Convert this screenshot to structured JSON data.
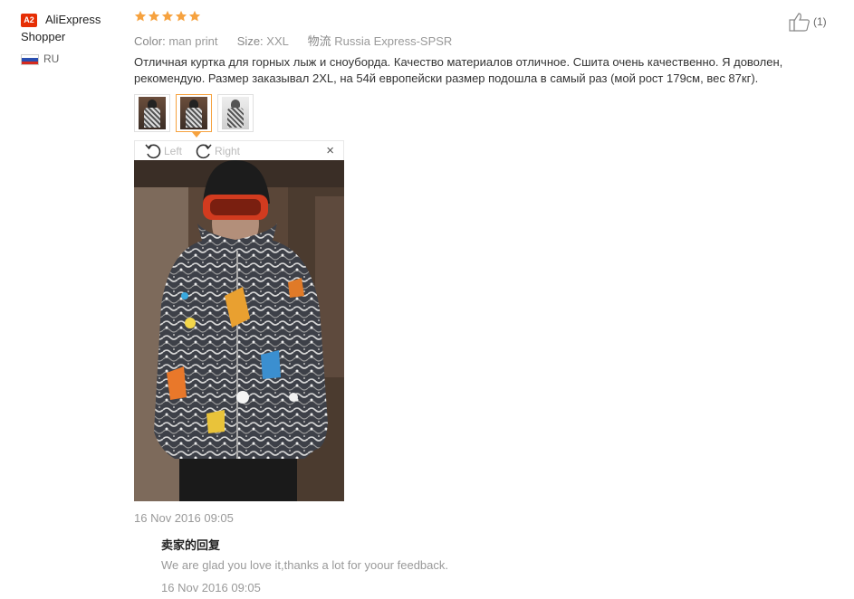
{
  "user": {
    "badge": "A2",
    "name": "AliExpress Shopper",
    "country": "RU",
    "flag_colors": [
      "#ffffff",
      "#2a4fb0",
      "#d52b1e"
    ]
  },
  "review": {
    "rating": 5,
    "star_color": "#f6a23f",
    "color_label": "Color:",
    "color_value": "man print",
    "size_label": "Size:",
    "size_value": "XXL",
    "shipping_label": "物流",
    "shipping_value": "Russia Express-SPSR",
    "text": "Отличная куртка для горных лыж и сноуборда. Качество материалов отличное. Сшита очень качественно. Я доволен, рекомендую. Размер заказывал 2XL, на 54й европейски размер подошла в самый раз (мой рост 179см, вес 87кг).",
    "date": "16 Nov 2016 09:05",
    "likes": "(1)"
  },
  "viewer": {
    "rotate_left": "Left",
    "rotate_right": "Right",
    "close": "×"
  },
  "seller_reply": {
    "title": "卖家的回复",
    "text": "We are glad you love it,thanks a lot for yoour feedback.",
    "date": "16 Nov 2016 09:05"
  }
}
